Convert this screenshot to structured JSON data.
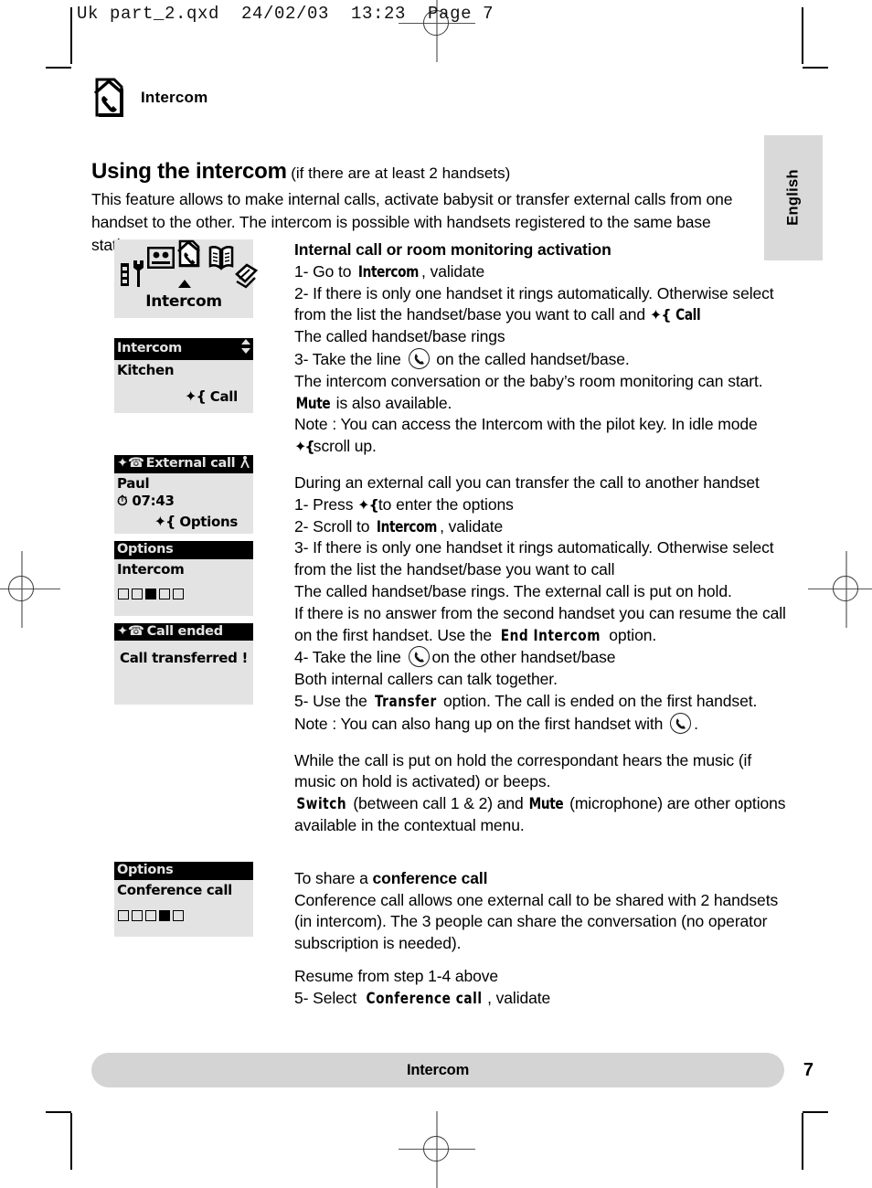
{
  "print_slug": "Uk part_2.qxd  24/02/03  13:23  Page 7",
  "chapter": {
    "icon": "intercom-house-phone-icon",
    "title": "Intercom"
  },
  "language_tab": "English",
  "section": {
    "heading": "Using the intercom",
    "heading_note": "(if there are at least 2 handsets)",
    "intro": "This feature allows to make internal calls, activate babysit or transfer external calls from one handset to the other. The intercom is possible with handsets registered to the same base station."
  },
  "screens": [
    {
      "id": "menu-carousel",
      "type": "carousel",
      "label": "Intercom",
      "icons": [
        "settings-tools-icon",
        "answering-machine-icon",
        "intercom-house-phone-icon",
        "phonebook-book-icon",
        "sms-pages-icon"
      ],
      "selected_index": 2
    },
    {
      "id": "intercom-list",
      "type": "list",
      "title": "Intercom",
      "title_right_icon": "scroll-updown-icon",
      "item": "Kitchen",
      "softkey": "Call"
    },
    {
      "id": "external-call",
      "type": "call",
      "title": "External call",
      "title_left_icon": "softkey-handset-icon",
      "title_right_icon": "antenna-icon",
      "caller": "Paul",
      "timer_icon": "stopwatch-icon",
      "timer": "07:43",
      "softkey": "Options"
    },
    {
      "id": "options-intercom",
      "type": "options",
      "title": "Options",
      "item": "Intercom",
      "dots_total": 5,
      "dots_active": 3
    },
    {
      "id": "call-ended",
      "type": "message",
      "title": "Call ended",
      "title_left_icon": "softkey-handset-icon",
      "message": "Call transferred !"
    },
    {
      "id": "options-conference",
      "type": "options",
      "title": "Options",
      "item": "Conference call",
      "dots_total": 5,
      "dots_active": 4
    }
  ],
  "body": {
    "block1_heading": "Internal call or room monitoring activation",
    "b1_l1_a": "1- Go to ",
    "b1_l1_lcd": "Intercom",
    "b1_l1_b": ", validate",
    "b1_l2_a": "2- If there is only one handset it rings automatically. Otherwise select from the list the handset/base you want to call and ",
    "b1_l2_lcd": "Call",
    "b1_l3": "The called handset/base rings",
    "b1_l4_a": "3- Take the line ",
    "b1_l4_b": " on the called handset/base.",
    "b1_l5": "The intercom conversation or the baby’s room monitoring can start.",
    "b1_l6_lcd": "Mute",
    "b1_l6_b": " is also available.",
    "b1_l7": "Note : You can access the Intercom with the pilot key. In idle mode",
    "b1_l8": "scroll up.",
    "block2_l1": "During an external call you can transfer the call to another handset",
    "b2_l2_a": "1- Press ",
    "b2_l2_b": "to enter the options",
    "b2_l3_a": "2- Scroll to ",
    "b2_l3_lcd": "Intercom",
    "b2_l3_b": ", validate",
    "b2_l4": "3- If there is only one handset it rings automatically. Otherwise select from the list the handset/base you want to call",
    "b2_l5": "The called handset/base rings. The external call is put on hold.",
    "b2_l6_a": "If there is no answer from the second handset you can resume the call on the first handset. Use the ",
    "b2_l6_lcd": "End  Intercom",
    "b2_l6_b": " option.",
    "b2_l7_a": "4- Take the line ",
    "b2_l7_b": "on the other handset/base",
    "b2_l8": "Both internal callers can talk together.",
    "b2_l9_a": "5- Use the ",
    "b2_l9_lcd": "Transfer",
    "b2_l9_b": " option. The call is ended on the first handset.",
    "b2_l10_a": "Note : You can also hang up on the first handset with ",
    "b2_l10_b": ".",
    "block3_l1": "While the call is put on hold the correspondant hears the music (if music on hold is activated) or beeps.",
    "b3_l2_lcd1": "Switch",
    "b3_l2_a": " (between call 1 & 2) and ",
    "b3_l2_lcd2": "Mute",
    "b3_l2_b": " (microphone) are other options available in the contextual menu.",
    "block4_a": "To share a ",
    "block4_bold": "conference call",
    "b4_l2": "Conference call allows one external call to be shared with 2 handsets (in intercom). The 3 people can share the conversation (no operator subscription is needed).",
    "b4_l3": "Resume from step 1-4 above",
    "b4_l4_a": "5- Select ",
    "b4_l4_lcd": "Conference  call",
    "b4_l4_b": ", validate"
  },
  "footer": {
    "title": "Intercom",
    "page": "7"
  }
}
